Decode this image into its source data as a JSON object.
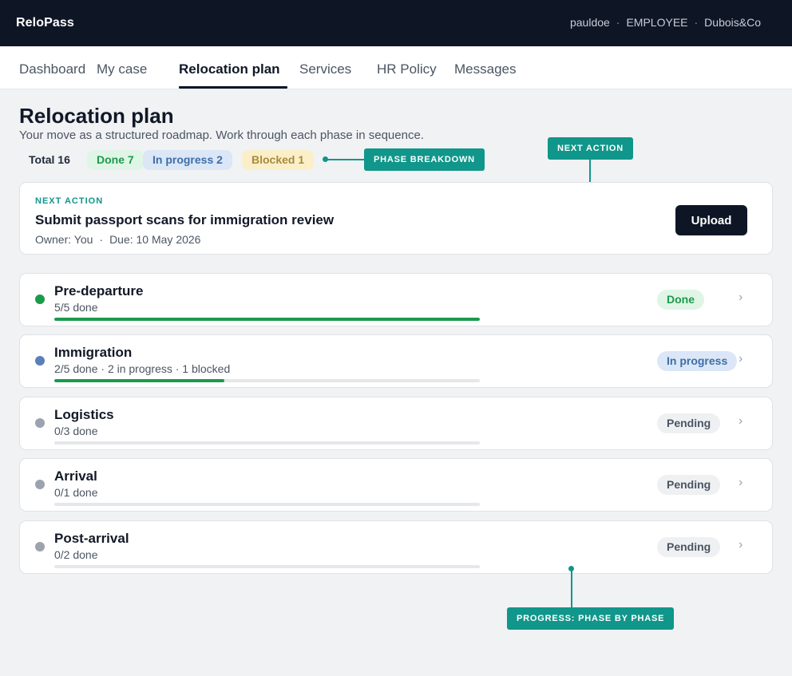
{
  "app": {
    "name": "ReloPass"
  },
  "user": {
    "username": "pauldoe",
    "role": "EMPLOYEE",
    "company": "Dubois&Co",
    "separator": "·"
  },
  "nav": {
    "tabs": [
      {
        "label": "Dashboard"
      },
      {
        "label": "My case"
      },
      {
        "label": "Relocation plan",
        "active": true
      },
      {
        "label": "Services"
      },
      {
        "label": "HR Policy"
      },
      {
        "label": "Messages"
      }
    ]
  },
  "page": {
    "title": "Relocation plan",
    "subtitle": "Your move as a structured roadmap. Work through each phase in sequence."
  },
  "summary": {
    "total": "Total 16",
    "done": "Done 7",
    "in_progress": "In progress 2",
    "blocked": "Blocked 1"
  },
  "annotations": {
    "phase_breakdown": "PHASE BREAKDOWN",
    "next_action": "NEXT ACTION",
    "progress": "PROGRESS: PHASE BY PHASE"
  },
  "next_action": {
    "eyebrow": "NEXT ACTION",
    "title": "Submit passport scans for immigration review",
    "owner": "Owner: You",
    "separator": "·",
    "due": "Due: 10 May 2026",
    "button_label": "Upload"
  },
  "phases": [
    {
      "name": "Pre-departure",
      "detail": "5/5 done",
      "status": "Done",
      "progress": 1.0,
      "dot_color": "#1b9a4b"
    },
    {
      "name": "Immigration",
      "detail": "2/5 done · 2 in progress · 1 blocked",
      "status": "In progress",
      "progress": 0.4,
      "dot_color": "#5b7fb8"
    },
    {
      "name": "Logistics",
      "detail": "0/3 done",
      "status": "Pending",
      "progress": 0,
      "dot_color": "#9ca3af"
    },
    {
      "name": "Arrival",
      "detail": "0/1 done",
      "status": "Pending",
      "progress": 0,
      "dot_color": "#9ca3af"
    },
    {
      "name": "Post-arrival",
      "detail": "0/2 done",
      "status": "Pending",
      "progress": 0,
      "dot_color": "#9ca3af"
    }
  ],
  "chevron": "›",
  "colors": {
    "accent": "#10968a",
    "topbar": "#0e1626",
    "success": "#1b9a4b"
  }
}
